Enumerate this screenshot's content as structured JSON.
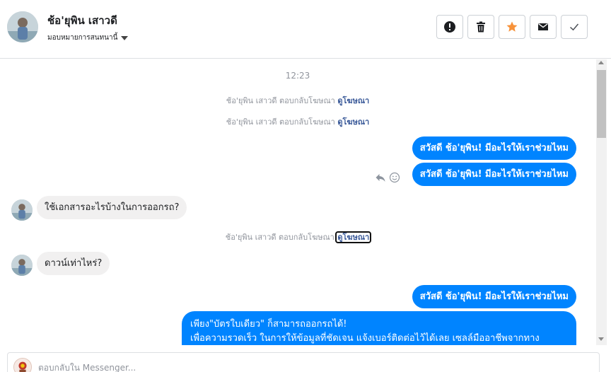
{
  "header": {
    "contact_name": "ช้อ'ยุพิน เสาวดี",
    "assign_label": "มอบหมายการสนทนานี้",
    "actions": [
      {
        "name": "mark-spam",
        "icon": "alert-circle-icon"
      },
      {
        "name": "delete",
        "icon": "trash-icon"
      },
      {
        "name": "star",
        "icon": "star-icon",
        "color": "#f7923a"
      },
      {
        "name": "mark-unread",
        "icon": "envelope-icon"
      },
      {
        "name": "mark-done",
        "icon": "checkmark-icon"
      }
    ]
  },
  "thread": {
    "timestamp": "12:23",
    "system_prefix": "ช้อ'ยุพิน เสาวดี ตอบกลับโฆษณา",
    "system_link": "ดูโฆษณา",
    "outgoing_greeting": "สวัสดี ช้อ'ยุพิน! มีอะไรให้เราช่วยไหม",
    "incoming_1": "ใช้เอกสารอะไรบ้างในการออกรถ?",
    "incoming_2": "ดาวน์เท่าไหร่?",
    "long_reply_line1": "เพียง\"บัตรใบเดียว\" ก็สามารถออกรถได้!",
    "long_reply_line2": "เพื่อความรวดเร็ว ในการให้ข้อมูลที่ชัดเจน แจ้งเบอร์ติดต่อไว้ได้เลย เซลล์มืออาชีพจากทาง",
    "tools": [
      "reply-icon",
      "smile-icon"
    ]
  },
  "composer": {
    "placeholder": "ตอบกลับใน Messenger..."
  },
  "colors": {
    "accent": "#0084ff",
    "link": "#385898",
    "star": "#f7923a"
  }
}
